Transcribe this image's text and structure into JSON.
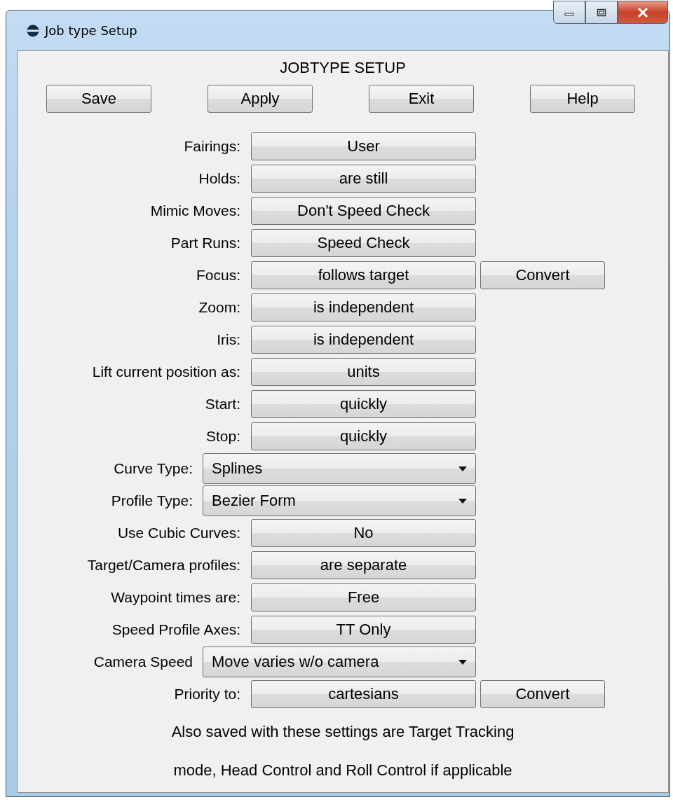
{
  "window": {
    "title": "Job type Setup"
  },
  "heading": "JOBTYPE SETUP",
  "top_buttons": [
    "Save",
    "Apply",
    "Exit",
    "Help"
  ],
  "rows": [
    {
      "label": "Fairings:",
      "kind": "button",
      "value": "User"
    },
    {
      "label": "Holds:",
      "kind": "button",
      "value": "are still"
    },
    {
      "label": "Mimic Moves:",
      "kind": "button",
      "value": "Don't Speed Check"
    },
    {
      "label": "Part Runs:",
      "kind": "button",
      "value": "Speed Check"
    },
    {
      "label": "Focus:",
      "kind": "button",
      "value": "follows target",
      "extra_button": "Convert"
    },
    {
      "label": "Zoom:",
      "kind": "button",
      "value": "is independent"
    },
    {
      "label": "Iris:",
      "kind": "button",
      "value": "is independent"
    },
    {
      "label": "Lift current position as:",
      "kind": "button",
      "value": "units"
    },
    {
      "label": "Start:",
      "kind": "button",
      "value": "quickly"
    },
    {
      "label": "Stop:",
      "kind": "button",
      "value": "quickly"
    },
    {
      "label": "Curve Type:",
      "kind": "dropdown",
      "value": "Splines"
    },
    {
      "label": "Profile Type:",
      "kind": "dropdown",
      "value": "Bezier Form"
    },
    {
      "label": "Use Cubic Curves:",
      "kind": "button",
      "value": "No"
    },
    {
      "label": "Target/Camera profiles:",
      "kind": "button",
      "value": "are separate"
    },
    {
      "label": "Waypoint times are:",
      "kind": "button",
      "value": "Free"
    },
    {
      "label": "Speed Profile Axes:",
      "kind": "button",
      "value": "TT Only"
    },
    {
      "label": "Camera Speed",
      "kind": "dropdown",
      "value": "Move varies w/o camera"
    },
    {
      "label": "Priority to:",
      "kind": "button",
      "value": "cartesians",
      "extra_button": "Convert"
    }
  ],
  "note": [
    "Also saved with these settings are Target Tracking",
    "mode, Head Control and Roll Control if applicable"
  ]
}
